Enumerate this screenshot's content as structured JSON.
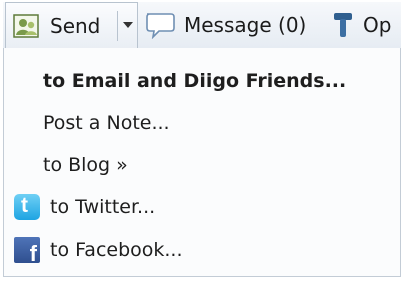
{
  "toolbar": {
    "send_label": "Send",
    "message_label": "Message (0)",
    "options_label": "Op"
  },
  "menu": {
    "items": [
      {
        "label": "to Email and Diigo Friends...",
        "icon": null,
        "bold": true
      },
      {
        "label": "Post a Note...",
        "icon": null,
        "bold": false
      },
      {
        "label": "to Blog »",
        "icon": null,
        "bold": false
      },
      {
        "label": "to Twitter...",
        "icon": "twitter-icon",
        "bold": false
      },
      {
        "label": "to Facebook...",
        "icon": "facebook-icon",
        "bold": false
      }
    ]
  },
  "colors": {
    "toolbar_bg": "#e6ecf3",
    "menu_bg": "#fbfcfd",
    "border": "#c3ccd6",
    "twitter": "#1ea4e2",
    "facebook": "#3b5998"
  }
}
